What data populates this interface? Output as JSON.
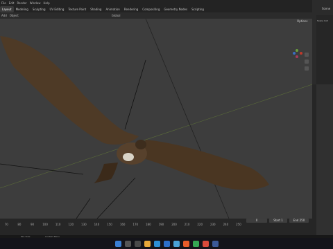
{
  "menu": [
    "File",
    "Edit",
    "Render",
    "Window",
    "Help"
  ],
  "workspace_tabs": [
    "Layout",
    "Modeling",
    "Sculpting",
    "UV Editing",
    "Texture Paint",
    "Shading",
    "Animation",
    "Rendering",
    "Compositing",
    "Geometry Nodes",
    "Scripting"
  ],
  "active_tab": "Layout",
  "viewport_header": {
    "mode": "Add",
    "object": "Object",
    "orientation": "Global"
  },
  "options_label": "Options",
  "outliner": {
    "scene": "Scene",
    "collection": "Scene Coll"
  },
  "timeline": {
    "ticks": [
      "70",
      "80",
      "90",
      "100",
      "110",
      "120",
      "130",
      "140",
      "150",
      "160",
      "170",
      "180",
      "190",
      "200",
      "210",
      "220",
      "230",
      "240",
      "250"
    ],
    "frame": "0",
    "start_label": "Start",
    "start": "1",
    "end_label": "End",
    "end": "250"
  },
  "statusbar": {
    "left": "Pan View",
    "right": "Context Menu"
  },
  "colors": {
    "accent": "#4772b3",
    "bird_brown": "#4e3a26",
    "viewport_bg": "#3d3d3d"
  }
}
